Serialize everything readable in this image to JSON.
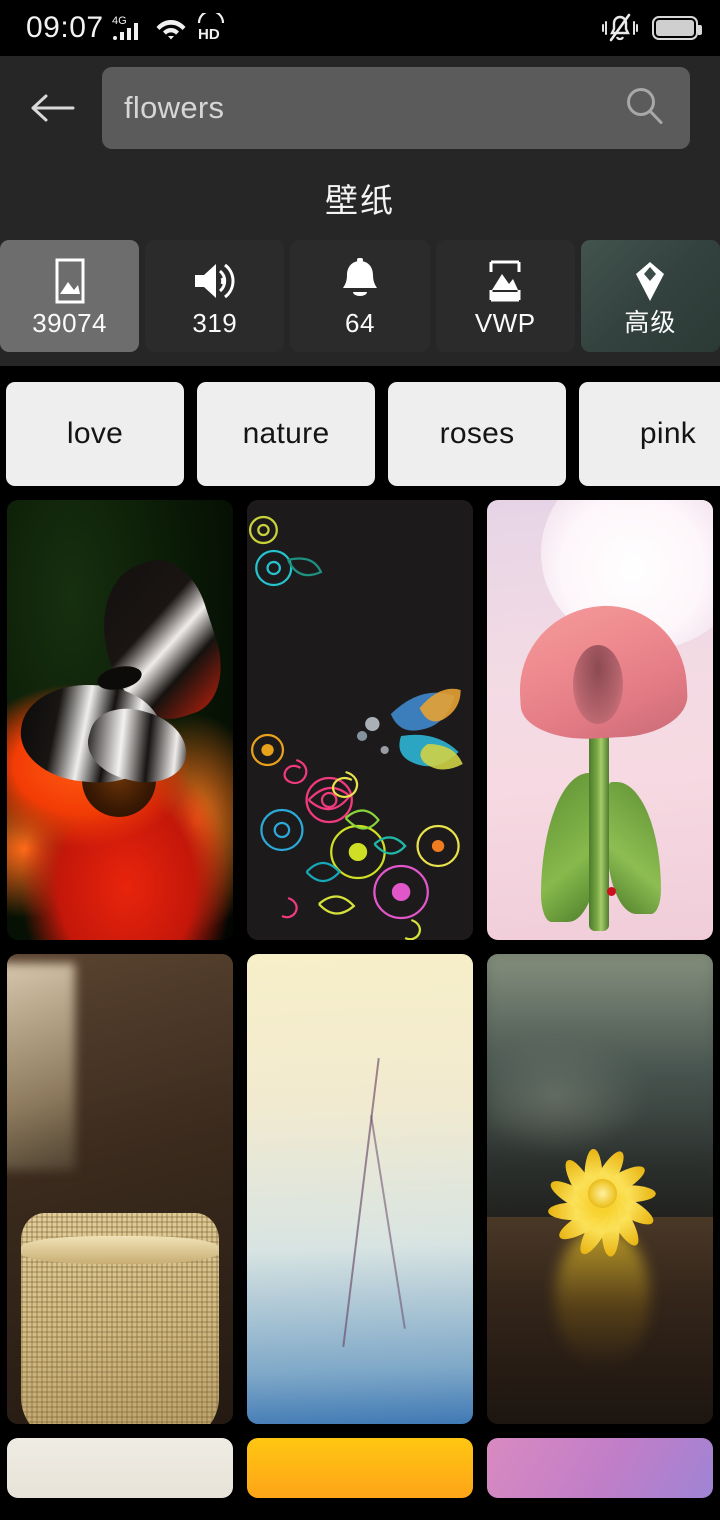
{
  "statusbar": {
    "time": "09:07",
    "network_label": "4G",
    "signal_icon": "signal-bars-icon",
    "wifi_icon": "wifi-icon",
    "hd_label": "HD",
    "vibrate_icon": "vibrate-silent-icon",
    "battery_icon": "battery-icon"
  },
  "header": {
    "back_icon": "back-arrow-icon",
    "search": {
      "value": "flowers",
      "placeholder": "Search",
      "icon": "search-icon"
    },
    "title": "壁纸"
  },
  "tabs": [
    {
      "icon": "image-icon",
      "label": "39074",
      "selected": true,
      "premium": false
    },
    {
      "icon": "speaker-icon",
      "label": "319",
      "selected": false,
      "premium": false
    },
    {
      "icon": "bell-icon",
      "label": "64",
      "selected": false,
      "premium": false
    },
    {
      "icon": "live-wallpaper-icon",
      "label": "VWP",
      "selected": false,
      "premium": false
    },
    {
      "icon": "diamond-icon",
      "label": "高级",
      "selected": false,
      "premium": true
    }
  ],
  "chips": [
    {
      "label": "love"
    },
    {
      "label": "nature"
    },
    {
      "label": "roses"
    },
    {
      "label": "pink"
    }
  ],
  "grid": {
    "rows": [
      [
        {
          "name": "butterfly-on-orange-flower"
        },
        {
          "name": "black-doodle-flowers"
        },
        {
          "name": "pink-calla-lily-moon"
        }
      ],
      [
        {
          "name": "pink-blossom-burlap-pot"
        },
        {
          "name": "pink-cherry-blossom-branch"
        },
        {
          "name": "yellow-daisy-reflection"
        }
      ],
      [
        {
          "name": "cream-wallpaper-partial"
        },
        {
          "name": "orange-gradient-wallpaper-partial"
        },
        {
          "name": "pink-purple-gradient-wallpaper-partial"
        }
      ]
    ]
  },
  "colors": {
    "app_background": "#000000",
    "header_background": "#262626",
    "tab_background": "#2b2b2b",
    "tab_selected_background": "#6d6d6d",
    "tab_premium_background": "#3a4a46",
    "chip_background": "#eeeeee",
    "chip_text": "#141414",
    "search_background": "#5b5b5b",
    "text_primary": "#f4f4f4"
  }
}
